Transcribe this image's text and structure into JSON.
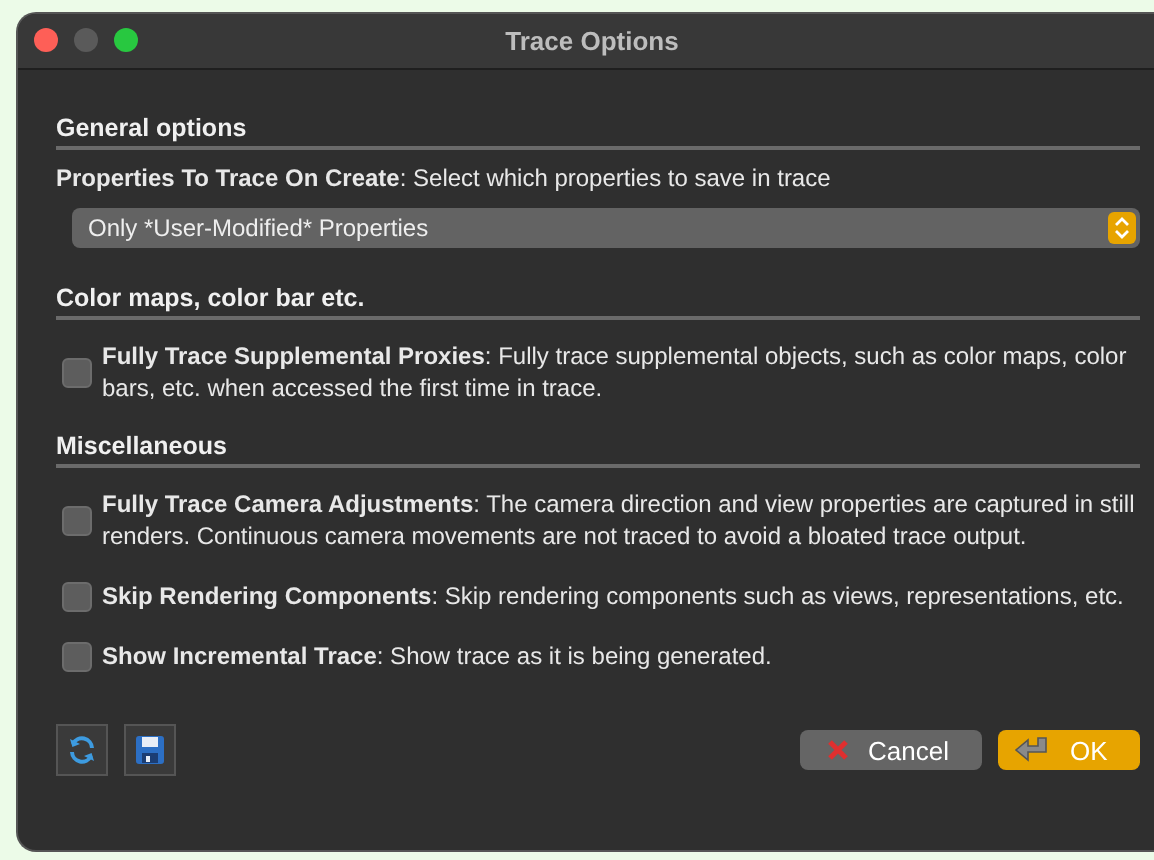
{
  "window": {
    "title": "Trace Options"
  },
  "sections": [
    {
      "heading": "General options",
      "items": [
        {
          "kind": "dropdown",
          "label": "**Properties To Trace On Create**: Select which properties to save in trace",
          "value": "Only *User-Modified* Properties"
        }
      ]
    },
    {
      "heading": "Color maps, color bar etc.",
      "items": [
        {
          "kind": "checkbox",
          "checked": false,
          "label": "**Fully Trace Supplemental Proxies**: Fully trace supplemental objects, such as color maps, color bars, etc. when accessed the first time in trace."
        }
      ]
    },
    {
      "heading": "Miscellaneous",
      "items": [
        {
          "kind": "checkbox",
          "checked": false,
          "label": "**Fully Trace Camera Adjustments**: The camera direction and view properties are captured in still renders. Continuous camera movements are not traced to avoid a bloated trace output."
        },
        {
          "kind": "checkbox",
          "checked": false,
          "label": "**Skip Rendering Components**: Skip rendering components such as views, representations, etc."
        },
        {
          "kind": "checkbox",
          "checked": false,
          "label": "**Show Incremental Trace**: Show trace as it is being generated."
        }
      ]
    }
  ],
  "buttons": [
    {
      "label": "Cancel",
      "kind": "cancel"
    },
    {
      "label": "OK",
      "kind": "ok"
    }
  ]
}
